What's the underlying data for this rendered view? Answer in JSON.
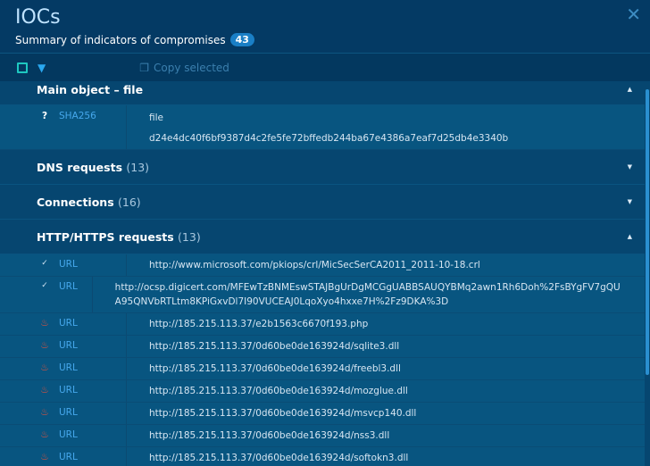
{
  "header": {
    "title": "IOCs",
    "subtitle": "Summary of indicators of compromises",
    "count": "43"
  },
  "toolbar": {
    "copy_label": "Copy selected"
  },
  "main_object": {
    "title": "Main object – file",
    "key": "SHA256",
    "type": "file",
    "hash": "d24e4dc40f6bf9387d4c2fe5fe72bffedb244ba67e4386a7eaf7d25db4e3340b"
  },
  "sections": [
    {
      "title": "DNS requests",
      "count": "(13)"
    },
    {
      "title": "Connections",
      "count": "(16)"
    },
    {
      "title": "HTTP/HTTPS requests",
      "count": "(13)"
    }
  ],
  "http_rows": [
    {
      "icon": "check-circle",
      "key": "URL",
      "value": "http://www.microsoft.com/pkiops/crl/MicSecSerCA2011_2011-10-18.crl"
    },
    {
      "icon": "check-circle",
      "key": "URL",
      "value": "http://ocsp.digicert.com/MFEwTzBNMEswSTAJBgUrDgMCGgUABBSAUQYBMq2awn1Rh6Doh%2FsBYgFV7gQUA95QNVbRTLtm8KPiGxvDl7I90VUCEAJ0LqoXyo4hxxe7H%2Fz9DKA%3D"
    },
    {
      "icon": "fire",
      "key": "URL",
      "value": "http://185.215.113.37/e2b1563c6670f193.php"
    },
    {
      "icon": "fire",
      "key": "URL",
      "value": "http://185.215.113.37/0d60be0de163924d/sqlite3.dll"
    },
    {
      "icon": "fire",
      "key": "URL",
      "value": "http://185.215.113.37/0d60be0de163924d/freebl3.dll"
    },
    {
      "icon": "fire",
      "key": "URL",
      "value": "http://185.215.113.37/0d60be0de163924d/mozglue.dll"
    },
    {
      "icon": "fire",
      "key": "URL",
      "value": "http://185.215.113.37/0d60be0de163924d/msvcp140.dll"
    },
    {
      "icon": "fire",
      "key": "URL",
      "value": "http://185.215.113.37/0d60be0de163924d/nss3.dll"
    },
    {
      "icon": "fire",
      "key": "URL",
      "value": "http://185.215.113.37/0d60be0de163924d/softokn3.dll"
    }
  ],
  "colors": {
    "malicious": "#e8503a",
    "safe": "#cfe3f2",
    "accent": "#1a7fc6"
  }
}
